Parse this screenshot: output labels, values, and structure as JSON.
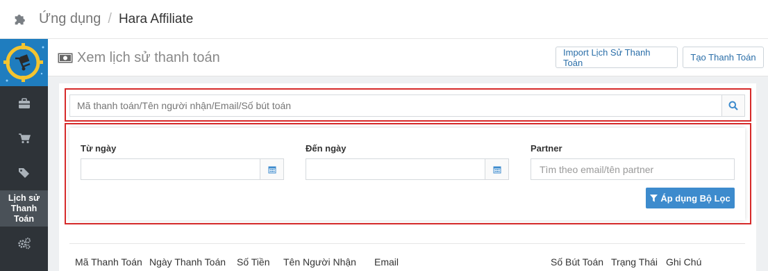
{
  "breadcrumb": {
    "app": "Ứng dụng",
    "separator": "/",
    "current": "Hara Affiliate"
  },
  "sidebar": {
    "items": [
      {
        "icon": "briefcase-icon"
      },
      {
        "icon": "cart-icon"
      },
      {
        "icon": "tags-icon"
      },
      {
        "label": "Lịch sử Thanh Toán",
        "line1": "Lịch sử",
        "line2": "Thanh Toán",
        "active": true
      },
      {
        "icon": "gears-icon"
      }
    ]
  },
  "page": {
    "title": "Xem lịch sử thanh toán",
    "import_button": "Import Lịch Sử Thanh Toán",
    "create_button": "Tạo Thanh Toán"
  },
  "search": {
    "placeholder": "Mã thanh toán/Tên người nhận/Email/Số bút toán"
  },
  "filters": {
    "from_label": "Từ ngày",
    "to_label": "Đến ngày",
    "partner_label": "Partner",
    "partner_placeholder": "Tìm theo email/tên partner",
    "apply_button": "Áp dụng Bộ Lọc"
  },
  "table": {
    "headers": [
      "Mã Thanh Toán",
      "Ngày Thanh Toán",
      "Số Tiền",
      "Tên Người Nhận",
      "Email",
      "Số Bút Toán",
      "Trạng Thái",
      "Ghi Chú"
    ]
  },
  "colors": {
    "accent": "#3d8bcd",
    "sidebar": "#2e3338",
    "highlight": "#d62a2a"
  }
}
